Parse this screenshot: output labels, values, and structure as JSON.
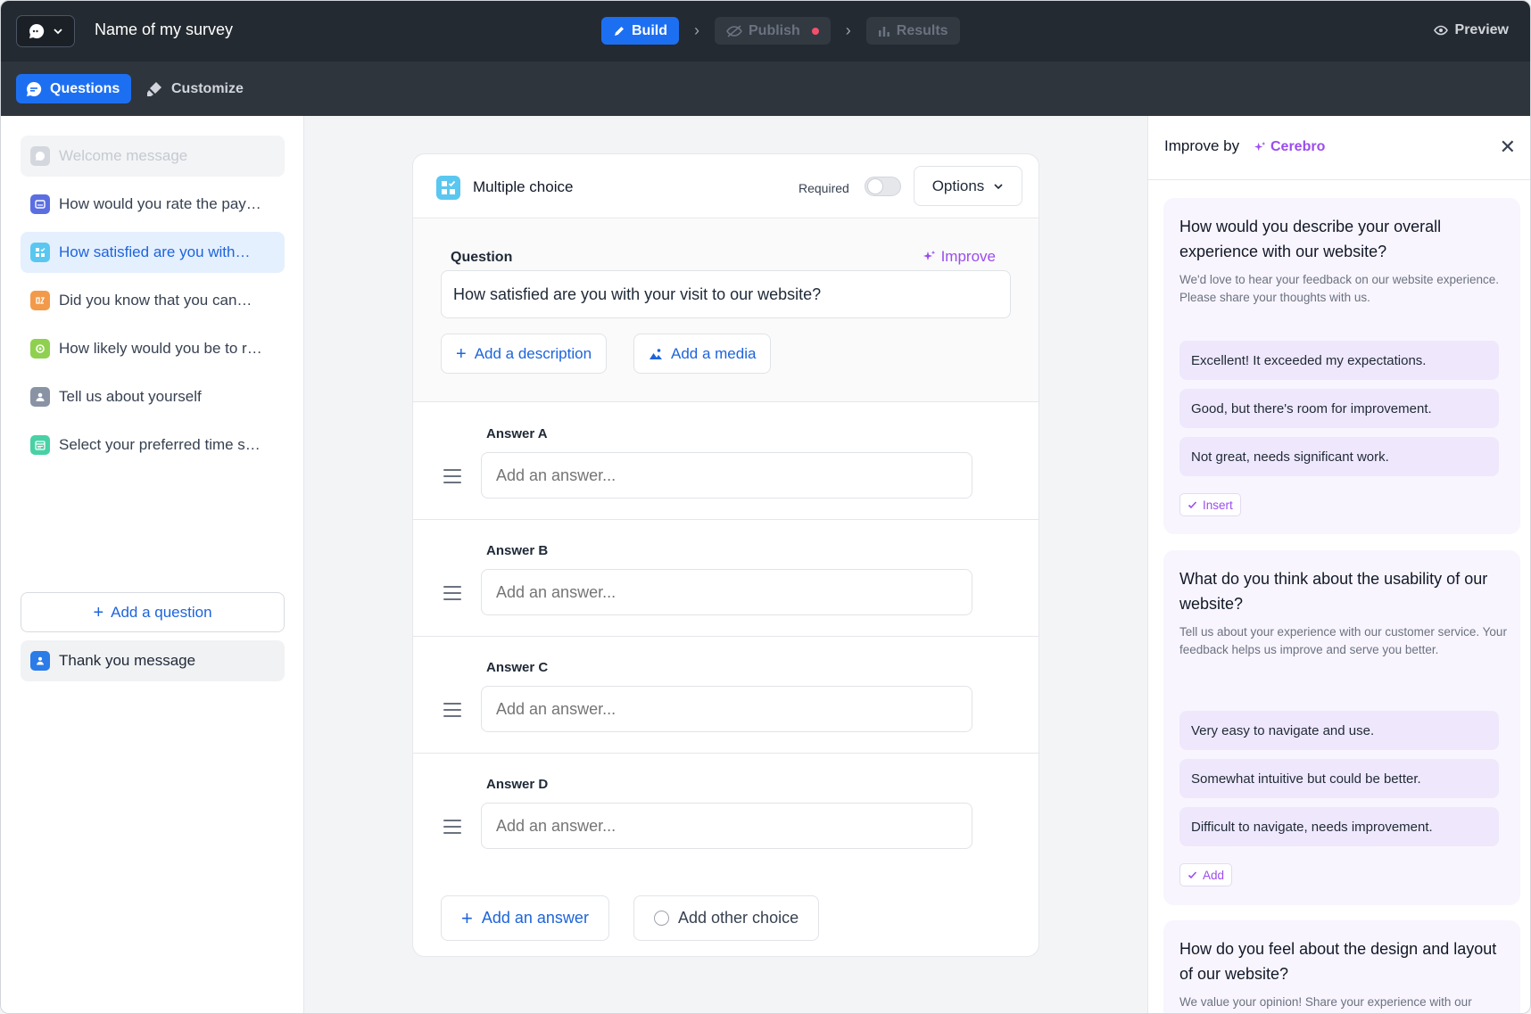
{
  "topbar": {
    "survey_name": "Name of my survey",
    "steps": [
      {
        "label": "Build",
        "icon": "pencil-icon"
      },
      {
        "label": "Publish",
        "icon": "eye-off-icon"
      },
      {
        "label": "Results",
        "icon": "bar-chart-icon"
      }
    ],
    "preview_label": "Preview"
  },
  "subbar": {
    "questions_tab": "Questions",
    "customize_tab": "Customize"
  },
  "sidebar": {
    "welcome": "Welcome message",
    "items": [
      {
        "label": "How would you rate the pay…",
        "icon": "rating-icon",
        "color": "#5b6ee1"
      },
      {
        "label": "How satisfied are you with…",
        "icon": "multiple-choice-icon",
        "color": "#5ac7f0"
      },
      {
        "label": "Did you know that you can…",
        "icon": "yes-no-icon",
        "color": "#f29a4a"
      },
      {
        "label": "How likely would you be to r…",
        "icon": "nps-icon",
        "color": "#8fd14f"
      },
      {
        "label": "Tell us about yourself",
        "icon": "contact-icon",
        "color": "#8993a4"
      },
      {
        "label": "Select your preferred time s…",
        "icon": "date-icon",
        "color": "#48d1a5"
      }
    ],
    "add_question": "Add a question",
    "thanks": "Thank you message"
  },
  "editor": {
    "type_label": "Multiple choice",
    "required_label": "Required",
    "required_on": false,
    "options_label": "Options",
    "question_label": "Question",
    "improve_label": "Improve",
    "question_value": "How satisfied are you with your visit to our website?",
    "add_description": "Add a description",
    "add_media": "Add a media",
    "answers": [
      {
        "label": "Answer A",
        "placeholder": "Add an answer..."
      },
      {
        "label": "Answer B",
        "placeholder": "Add an answer..."
      },
      {
        "label": "Answer C",
        "placeholder": "Add an answer..."
      },
      {
        "label": "Answer D",
        "placeholder": "Add an answer..."
      }
    ],
    "add_answer": "Add an answer",
    "add_other": "Add other choice"
  },
  "panel": {
    "title": "Improve by",
    "brand": "Cerebro",
    "suggestions": [
      {
        "title": "How would you describe your overall experience with our website?",
        "desc": "We'd love to hear your feedback on our website experience. Please share your thoughts with us.",
        "answers": [
          "Excellent! It exceeded my expectations.",
          "Good, but there's room for improvement.",
          "Not great, needs significant work."
        ],
        "action": "Insert"
      },
      {
        "title": "What do you think about the usability of our website?",
        "desc": "Tell us about your experience with our customer service. Your feedback helps us improve and serve you better.",
        "answers": [
          "Very easy to navigate and use.",
          "Somewhat intuitive but could be better.",
          "Difficult to navigate, needs improvement."
        ],
        "action": "Add"
      },
      {
        "title": "How do you feel about the design and layout of our website?",
        "desc": "We value your opinion! Share your experience with our"
      }
    ]
  },
  "colors": {
    "accent": "#1d6ff2",
    "ai_purple": "#9b4dee",
    "topbar": "#242a31",
    "publish_dot": "#f0506e"
  }
}
